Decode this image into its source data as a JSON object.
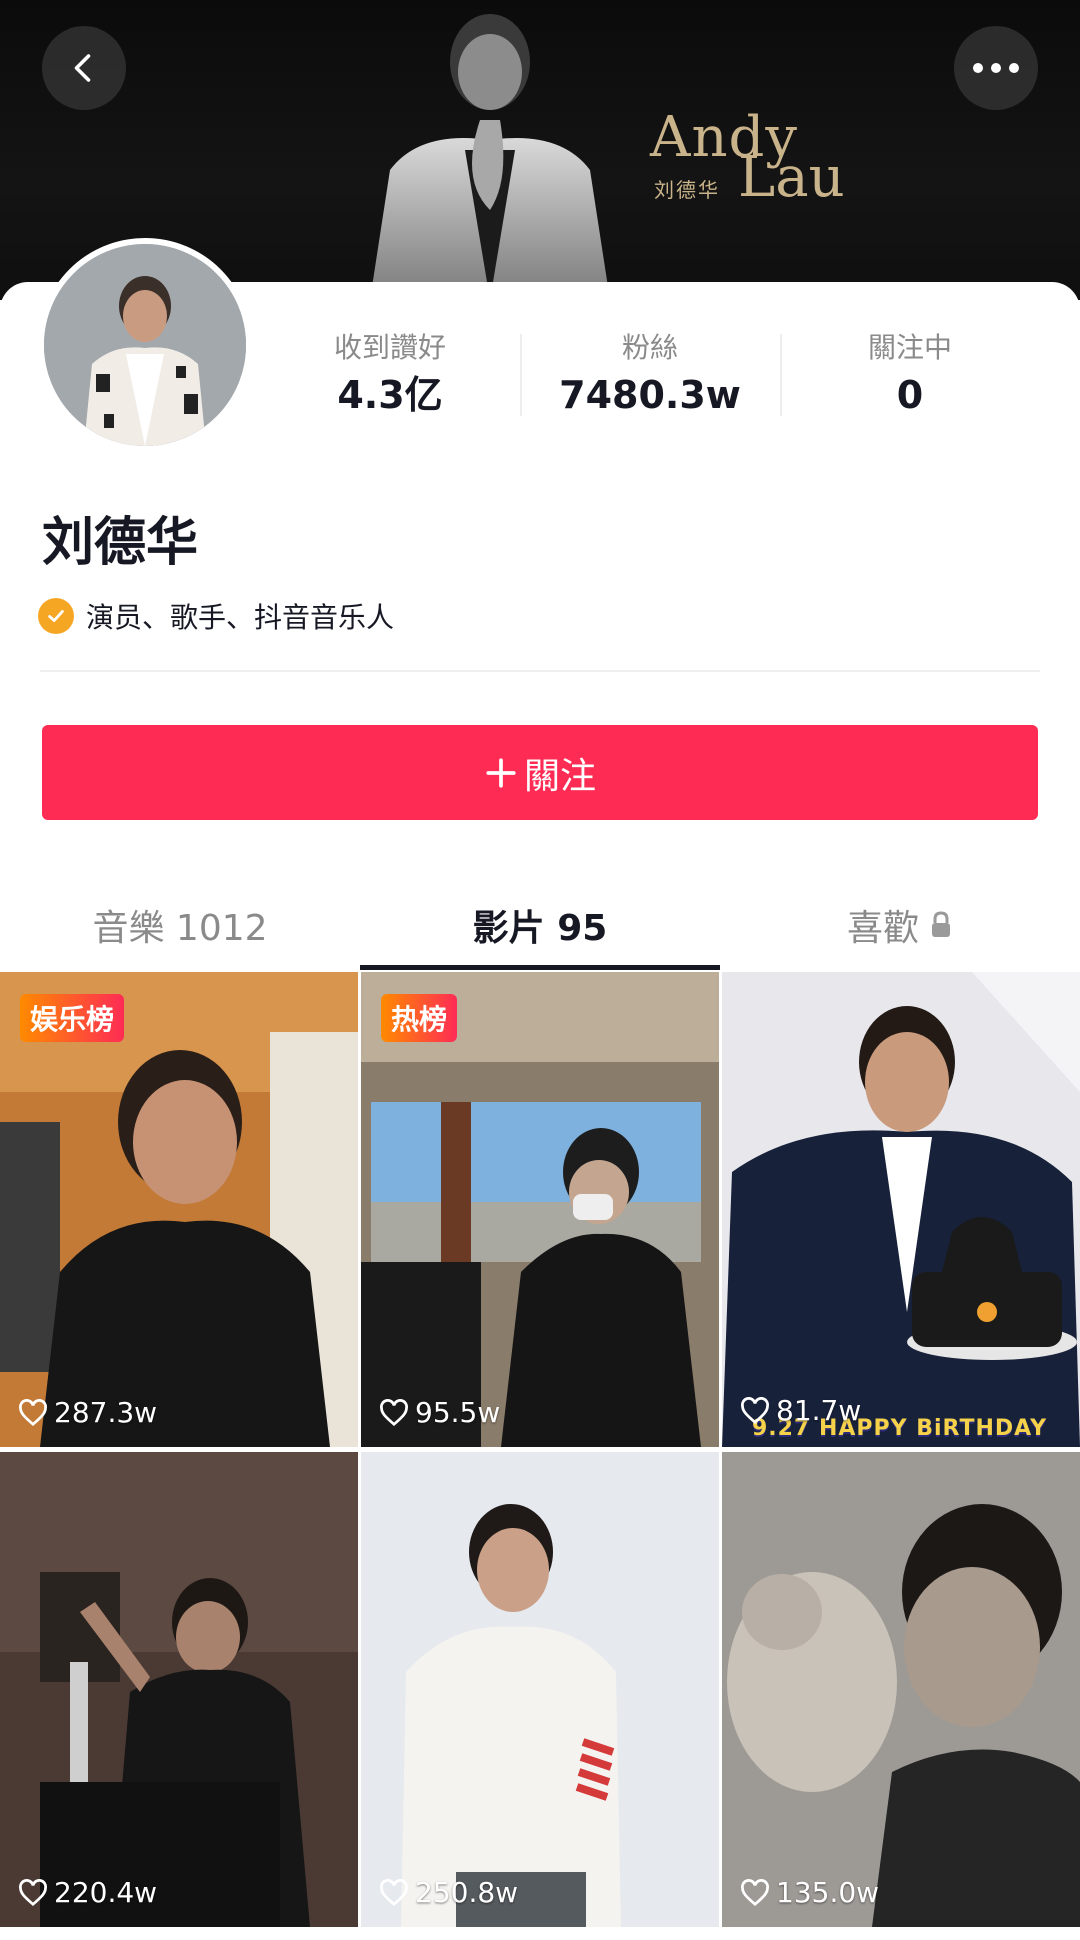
{
  "banner": {
    "brand_en_first": "Andy",
    "brand_en_last": "Lau",
    "brand_cn": "刘德华"
  },
  "header": {
    "back_icon": "chevron-left-icon",
    "more_icon": "more-horizontal-icon"
  },
  "profile": {
    "name": "刘德华",
    "verified_text": "演员、歌手、抖音音乐人",
    "stats": [
      {
        "label": "收到讚好",
        "value": "4.3亿"
      },
      {
        "label": "粉絲",
        "value": "7480.3w"
      },
      {
        "label": "關注中",
        "value": "0"
      }
    ],
    "follow_label": "關注"
  },
  "tabs": [
    {
      "label": "音樂 1012",
      "active": false
    },
    {
      "label": "影片 95",
      "active": true
    },
    {
      "label": "喜歡",
      "active": false,
      "icon": "lock-icon"
    }
  ],
  "videos": [
    {
      "tag": "娱乐榜",
      "likes": "287.3w"
    },
    {
      "tag": "热榜",
      "likes": "95.5w"
    },
    {
      "tag": "",
      "likes": "81.7w",
      "overlay_text": "9.27 HAPPY BiRTHDAY"
    },
    {
      "tag": "",
      "likes": "220.4w"
    },
    {
      "tag": "",
      "likes": "250.8w"
    },
    {
      "tag": "",
      "likes": "135.0w"
    }
  ],
  "colors": {
    "accent": "#fe2c55",
    "verified": "#f5a623",
    "text_primary": "#161823",
    "text_secondary": "#8a8a8a"
  }
}
